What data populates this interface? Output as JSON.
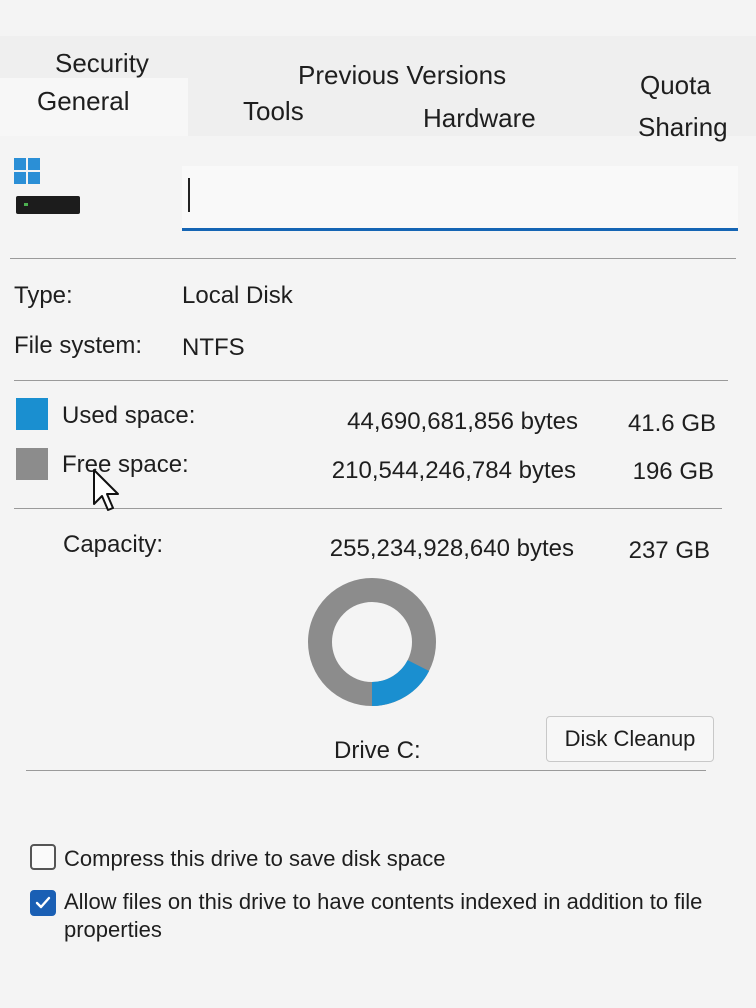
{
  "tabs": {
    "security": "Security",
    "previous_versions": "Previous Versions",
    "quota": "Quota",
    "general": "General",
    "tools": "Tools",
    "hardware": "Hardware",
    "sharing": "Sharing"
  },
  "drive": {
    "name_value": "",
    "type_label": "Type:",
    "type_value": "Local Disk",
    "fs_label": "File system:",
    "fs_value": "NTFS"
  },
  "space": {
    "used_label": "Used space:",
    "used_bytes": "44,690,681,856 bytes",
    "used_size": "41.6 GB",
    "used_color": "#1a8fd0",
    "free_label": "Free space:",
    "free_bytes": "210,544,246,784 bytes",
    "free_size": "196 GB",
    "free_color": "#8c8c8c",
    "capacity_label": "Capacity:",
    "capacity_bytes": "255,234,928,640 bytes",
    "capacity_size": "237 GB",
    "used_fraction": 0.175
  },
  "drive_label": "Drive C:",
  "disk_cleanup_label": "Disk Cleanup",
  "options": {
    "compress_label": "Compress this drive to save disk space",
    "compress_checked": false,
    "index_label": "Allow files on this drive to have contents indexed in addition to file properties",
    "index_checked": true
  }
}
